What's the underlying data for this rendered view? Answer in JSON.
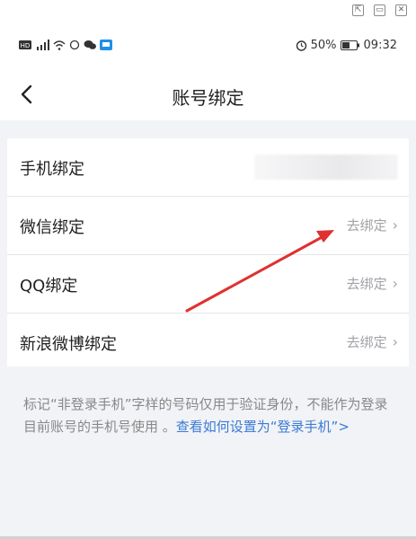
{
  "window_controls": {
    "popout_icon": "popout-icon",
    "minimize_icon": "minimize-icon",
    "close_icon": "close-icon"
  },
  "status_bar": {
    "left_icons": [
      "hd-icon",
      "signal-icon",
      "wifi-icon",
      "alarm-outline-icon",
      "wechat-icon",
      "app-icon"
    ],
    "alarm_icon": "alarm-icon",
    "battery": "50%",
    "time": "09:32"
  },
  "nav": {
    "title": "账号绑定",
    "back_icon": "back-chevron-icon"
  },
  "bindings": [
    {
      "label": "手机绑定",
      "action": ""
    },
    {
      "label": "微信绑定",
      "action": "去绑定"
    },
    {
      "label": "QQ绑定",
      "action": "去绑定"
    },
    {
      "label": "新浪微博绑定",
      "action": "去绑定"
    }
  ],
  "footnote": {
    "text": "标记“非登录手机”字样的号码仅用于验证身份，不能作为登录目前账号的手机号使用 。",
    "link": "查看如何设置为“登录手机”>"
  },
  "colors": {
    "accent_link": "#3a7bd5",
    "annotation_arrow": "#e03030"
  }
}
